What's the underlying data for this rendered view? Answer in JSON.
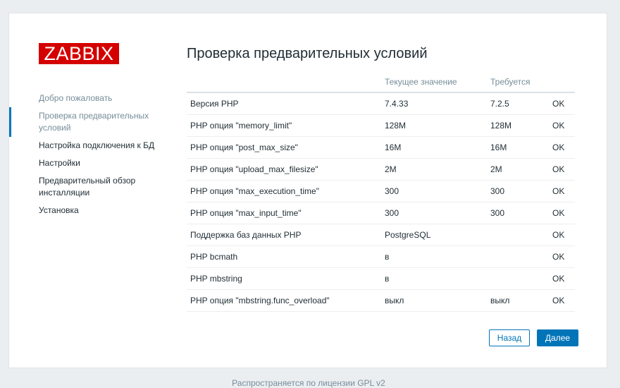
{
  "logo": "ZABBIX",
  "nav": [
    {
      "label": "Добро пожаловать",
      "state": "done"
    },
    {
      "label": "Проверка предварительных условий",
      "state": "current"
    },
    {
      "label": "Настройка подключения к БД",
      "state": "pending"
    },
    {
      "label": "Настройки",
      "state": "pending"
    },
    {
      "label": "Предварительный обзор инсталляции",
      "state": "pending"
    },
    {
      "label": "Установка",
      "state": "pending"
    }
  ],
  "title": "Проверка предварительных условий",
  "table": {
    "headers": [
      "",
      "Текущее значение",
      "Требуется",
      ""
    ],
    "rows": [
      {
        "name": "Версия PHP",
        "current": "7.4.33",
        "required": "7.2.5",
        "status": "OK"
      },
      {
        "name": "PHP опция \"memory_limit\"",
        "current": "128M",
        "required": "128M",
        "status": "OK"
      },
      {
        "name": "PHP опция \"post_max_size\"",
        "current": "16M",
        "required": "16M",
        "status": "OK"
      },
      {
        "name": "PHP опция \"upload_max_filesize\"",
        "current": "2M",
        "required": "2M",
        "status": "OK"
      },
      {
        "name": "PHP опция \"max_execution_time\"",
        "current": "300",
        "required": "300",
        "status": "OK"
      },
      {
        "name": "PHP опция \"max_input_time\"",
        "current": "300",
        "required": "300",
        "status": "OK"
      },
      {
        "name": "Поддержка баз данных PHP",
        "current": "PostgreSQL",
        "required": "",
        "status": "OK"
      },
      {
        "name": "PHP bcmath",
        "current": "в",
        "required": "",
        "status": "OK"
      },
      {
        "name": "PHP mbstring",
        "current": "в",
        "required": "",
        "status": "OK"
      },
      {
        "name": "PHP опция \"mbstring.func_overload\"",
        "current": "выкл",
        "required": "выкл",
        "status": "OK"
      }
    ]
  },
  "buttons": {
    "back": "Назад",
    "next": "Далее"
  },
  "footer": "Распространяется по лицензии GPL v2",
  "colors": {
    "brand": "#d40000",
    "accent": "#0275b8",
    "ok": "#429e47"
  }
}
